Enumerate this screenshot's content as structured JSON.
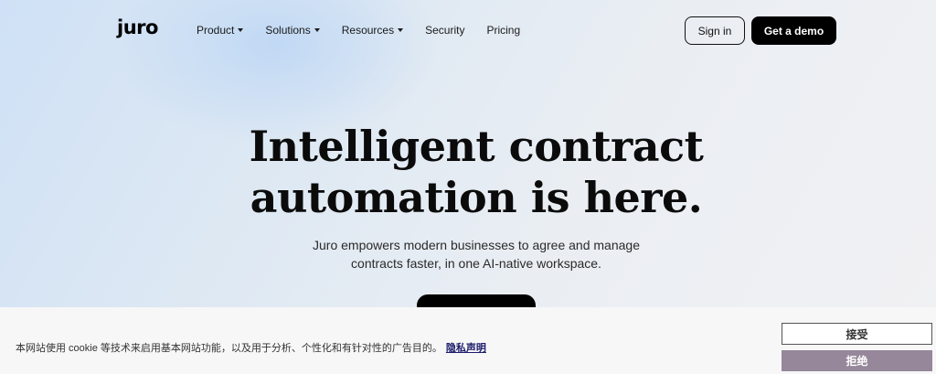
{
  "nav": {
    "logo": "juro",
    "items": [
      {
        "label": "Product",
        "has_dropdown": true
      },
      {
        "label": "Solutions",
        "has_dropdown": true
      },
      {
        "label": "Resources",
        "has_dropdown": true
      },
      {
        "label": "Security",
        "has_dropdown": false
      },
      {
        "label": "Pricing",
        "has_dropdown": false
      }
    ],
    "signin_label": "Sign in",
    "demo_label": "Get a demo"
  },
  "hero": {
    "title_line1": "Intelligent contract",
    "title_line2": "automation is here.",
    "subtitle_line1": "Juro empowers modern businesses to agree and manage",
    "subtitle_line2": "contracts faster, in one AI-native workspace."
  },
  "cookie_banner": {
    "text": "本网站使用 cookie 等技术来启用基本网站功能，以及用于分析、个性化和有针对性的广告目的。",
    "link_label": "隐私声明",
    "accept_label": "接受",
    "reject_label": "拒绝"
  },
  "colors": {
    "primary_button": "#000000",
    "reject_button": "#96879a",
    "link": "#1c1b6b"
  }
}
